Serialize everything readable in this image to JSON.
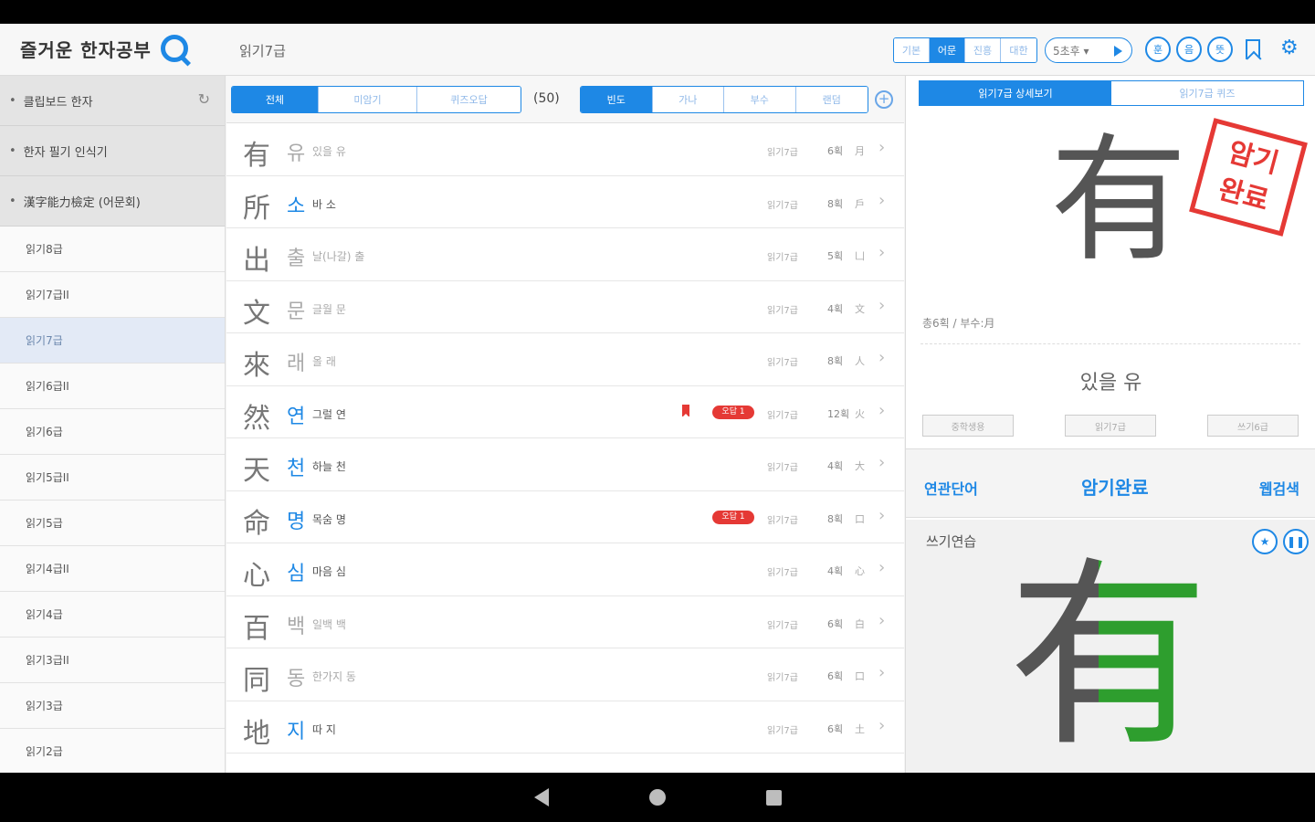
{
  "header": {
    "logo_text": "즐거운 한자공부",
    "title": "읽기7급",
    "mode_tabs": [
      {
        "label": "기본",
        "active": false
      },
      {
        "label": "어문",
        "active": true
      },
      {
        "label": "진흥",
        "active": false
      },
      {
        "label": "대한",
        "active": false
      }
    ],
    "speed_label": "5초후 ▾",
    "circle_buttons": [
      "훈",
      "음",
      "뜻"
    ]
  },
  "sidebar": {
    "groups": [
      "클립보드 한자",
      "한자 필기 인식기",
      "漢字能力檢定 (어문회)"
    ],
    "items": [
      {
        "label": "읽기8급",
        "selected": false
      },
      {
        "label": "읽기7급II",
        "selected": false
      },
      {
        "label": "읽기7급",
        "selected": true
      },
      {
        "label": "읽기6급II",
        "selected": false
      },
      {
        "label": "읽기6급",
        "selected": false
      },
      {
        "label": "읽기5급II",
        "selected": false
      },
      {
        "label": "읽기5급",
        "selected": false
      },
      {
        "label": "읽기4급II",
        "selected": false
      },
      {
        "label": "읽기4급",
        "selected": false
      },
      {
        "label": "읽기3급II",
        "selected": false
      },
      {
        "label": "읽기3급",
        "selected": false
      },
      {
        "label": "읽기2급",
        "selected": false
      }
    ]
  },
  "list": {
    "filter_tabs": [
      {
        "label": "전체",
        "active": true
      },
      {
        "label": "미암기",
        "active": false
      },
      {
        "label": "퀴즈오답",
        "active": false
      }
    ],
    "count": "(50)",
    "sort_tabs": [
      {
        "label": "빈도",
        "active": true
      },
      {
        "label": "가나",
        "active": false
      },
      {
        "label": "부수",
        "active": false
      },
      {
        "label": "랜덤",
        "active": false
      }
    ],
    "wrong_badge": "오답 1",
    "rows": [
      {
        "han": "有",
        "eum": "유",
        "hun": "있을 유",
        "level": "읽기7급",
        "strokes": "6획",
        "radical": "月",
        "dim": true,
        "bookmark": false,
        "wrong": false
      },
      {
        "han": "所",
        "eum": "소",
        "hun": "바 소",
        "level": "읽기7급",
        "strokes": "8획",
        "radical": "戶",
        "dim": false,
        "bookmark": false,
        "wrong": false
      },
      {
        "han": "出",
        "eum": "출",
        "hun": "날(나갈) 출",
        "level": "읽기7급",
        "strokes": "5획",
        "radical": "凵",
        "dim": true,
        "bookmark": false,
        "wrong": false
      },
      {
        "han": "文",
        "eum": "문",
        "hun": "글월 문",
        "level": "읽기7급",
        "strokes": "4획",
        "radical": "文",
        "dim": true,
        "bookmark": false,
        "wrong": false
      },
      {
        "han": "來",
        "eum": "래",
        "hun": "올 래",
        "level": "읽기7급",
        "strokes": "8획",
        "radical": "人",
        "dim": true,
        "bookmark": false,
        "wrong": false
      },
      {
        "han": "然",
        "eum": "연",
        "hun": "그럴 연",
        "level": "읽기7급",
        "strokes": "12획",
        "radical": "火",
        "dim": false,
        "bookmark": true,
        "wrong": true
      },
      {
        "han": "天",
        "eum": "천",
        "hun": "하늘 천",
        "level": "읽기7급",
        "strokes": "4획",
        "radical": "大",
        "dim": false,
        "bookmark": false,
        "wrong": false
      },
      {
        "han": "命",
        "eum": "명",
        "hun": "목숨 명",
        "level": "읽기7급",
        "strokes": "8획",
        "radical": "口",
        "dim": false,
        "bookmark": false,
        "wrong": true
      },
      {
        "han": "心",
        "eum": "심",
        "hun": "마음 심",
        "level": "읽기7급",
        "strokes": "4획",
        "radical": "心",
        "dim": false,
        "bookmark": false,
        "wrong": false
      },
      {
        "han": "百",
        "eum": "백",
        "hun": "일백 백",
        "level": "읽기7급",
        "strokes": "6획",
        "radical": "白",
        "dim": true,
        "bookmark": false,
        "wrong": false
      },
      {
        "han": "同",
        "eum": "동",
        "hun": "한가지 동",
        "level": "읽기7급",
        "strokes": "6획",
        "radical": "口",
        "dim": true,
        "bookmark": false,
        "wrong": false
      },
      {
        "han": "地",
        "eum": "지",
        "hun": "따 지",
        "level": "읽기7급",
        "strokes": "6획",
        "radical": "土",
        "dim": false,
        "bookmark": false,
        "wrong": false
      }
    ]
  },
  "detail": {
    "tabs": [
      {
        "label": "읽기7급 상세보기",
        "active": true
      },
      {
        "label": "읽기7급 퀴즈",
        "active": false
      }
    ],
    "char": "有",
    "stamp_text": "암기\n완료",
    "meta": "총6획 / 부수:月",
    "meaning": "있을 유",
    "tags": [
      "중학생용",
      "읽기7급",
      "쓰기6급"
    ],
    "related_words": "연관단어",
    "memorized": "암기완료",
    "web_search": "웹검색",
    "writing_title": "쓰기연습",
    "writing_char": "有"
  }
}
